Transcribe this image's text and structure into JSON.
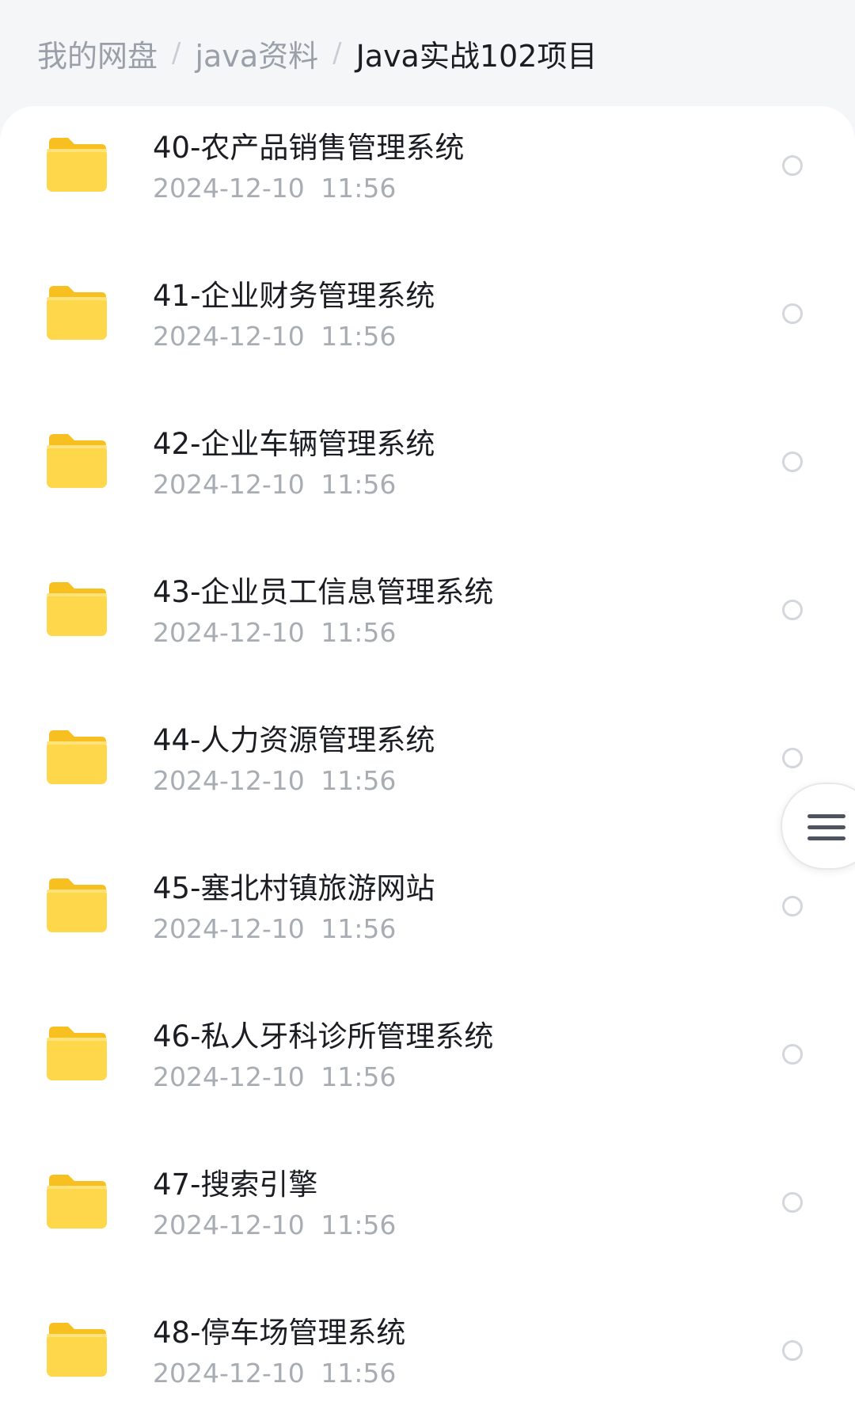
{
  "breadcrumb": {
    "items": [
      "我的网盘",
      "java资料",
      "Java实战102项目"
    ],
    "separator": "/"
  },
  "files": [
    {
      "name": "40-农产品销售管理系统",
      "date": "2024-12-10 11:56"
    },
    {
      "name": "41-企业财务管理系统",
      "date": "2024-12-10 11:56"
    },
    {
      "name": "42-企业车辆管理系统",
      "date": "2024-12-10 11:56"
    },
    {
      "name": "43-企业员工信息管理系统",
      "date": "2024-12-10 11:56"
    },
    {
      "name": "44-人力资源管理系统",
      "date": "2024-12-10 11:56"
    },
    {
      "name": "45-塞北村镇旅游网站",
      "date": "2024-12-10 11:56"
    },
    {
      "name": "46-私人牙科诊所管理系统",
      "date": "2024-12-10 11:56"
    },
    {
      "name": "47-搜索引擎",
      "date": "2024-12-10 11:56"
    },
    {
      "name": "48-停车场管理系统",
      "date": "2024-12-10 11:56"
    }
  ],
  "icons": {
    "folder": "folder-icon",
    "select": "select-radio",
    "menu": "menu-icon"
  },
  "colors": {
    "folder_front": "#ffd74a",
    "folder_back": "#f7bf1f",
    "breadcrumb_inactive": "#9aa0a9",
    "breadcrumb_active": "#1b1d22",
    "date_text": "#a8adb4"
  }
}
